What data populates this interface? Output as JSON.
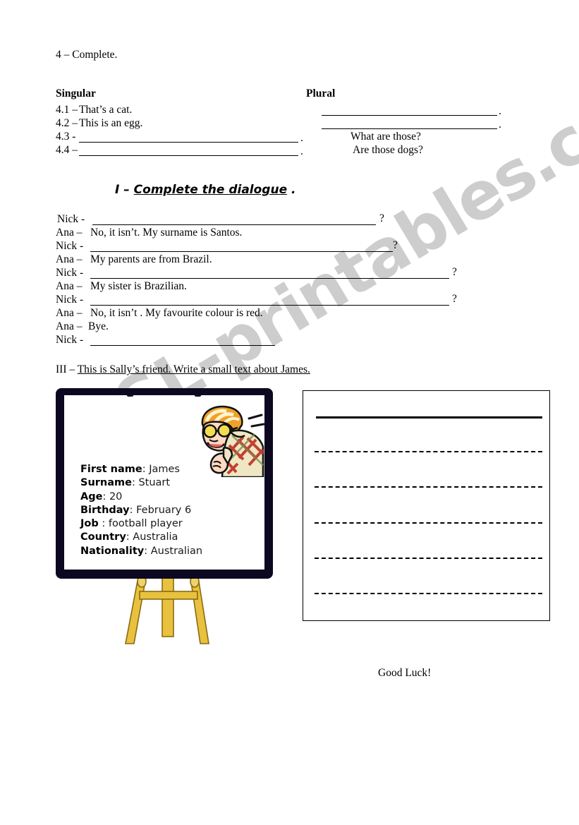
{
  "watermark": {
    "text": "ESL-printables.com",
    "color": "#c9c9c9"
  },
  "exercise4": {
    "title": "4 – Complete.",
    "col_singular": "Singular",
    "col_plural": "Plural",
    "rows": [
      {
        "num": "4.1 –",
        "singular": "That’s a cat.",
        "plural": ""
      },
      {
        "num": "4.2 –",
        "singular": "This is an egg.",
        "plural": ""
      },
      {
        "num": "4.3 -",
        "singular": "",
        "plural": "What are those?"
      },
      {
        "num": "4.4 –",
        "singular": "",
        "plural": "Are those dogs?"
      }
    ],
    "period": "."
  },
  "exercise1": {
    "heading_prefix": "I – ",
    "heading_underlined": "Complete the dialogue",
    "heading_suffix": " .",
    "lines": [
      {
        "speaker": "Nick -",
        "text": "",
        "blank": true,
        "mark": "?"
      },
      {
        "speaker": "Ana –",
        "text": "No, it   isn’t. My surname is Santos.",
        "blank": false,
        "mark": ""
      },
      {
        "speaker": "Nick -",
        "text": "",
        "blank": true,
        "mark": "?"
      },
      {
        "speaker": "Ana –",
        "text": "My parents are from Brazil.",
        "blank": false,
        "mark": ""
      },
      {
        "speaker": "Nick -",
        "text": "",
        "blank": true,
        "mark": "?"
      },
      {
        "speaker": "Ana –",
        "text": "My sister is Brazilian.",
        "blank": false,
        "mark": ""
      },
      {
        "speaker": "Nick -",
        "text": "",
        "blank": true,
        "mark": "?"
      },
      {
        "speaker": "Ana –",
        "text": " No, it isn’t . My favourite colour is red.",
        "blank": false,
        "mark": ""
      },
      {
        "speaker": "Ana –",
        "text": "Bye.",
        "blank": false,
        "mark": ""
      },
      {
        "speaker": "Nick -",
        "text": "",
        "blank": true,
        "mark": ""
      }
    ]
  },
  "exercise3": {
    "prefix": "III – ",
    "underlined": "This is Sally’s friend. Write a small text about James."
  },
  "id_card": {
    "frame_color": "#0c0820",
    "fields": [
      {
        "key": "First name",
        "sep": ": ",
        "value": "James"
      },
      {
        "key": "Surname",
        "sep": ": ",
        "value": "Stuart"
      },
      {
        "key": "Age",
        "sep": ": ",
        "value": "20"
      },
      {
        "key": "Birthday",
        "sep": ": ",
        "value": "February 6"
      },
      {
        "key": "Job",
        "sep": " : ",
        "value": "football player"
      },
      {
        "key": "Country",
        "sep": ": ",
        "value": "Australia"
      },
      {
        "key": "Nationality",
        "sep": ": ",
        "value": "Australian"
      }
    ]
  },
  "easel": {
    "wood_color": "#e8c13f",
    "wood_shadow": "#a8800f"
  },
  "answer_box": {
    "dashed_line_count": 5
  },
  "footer": {
    "good_luck": "Good Luck!"
  }
}
